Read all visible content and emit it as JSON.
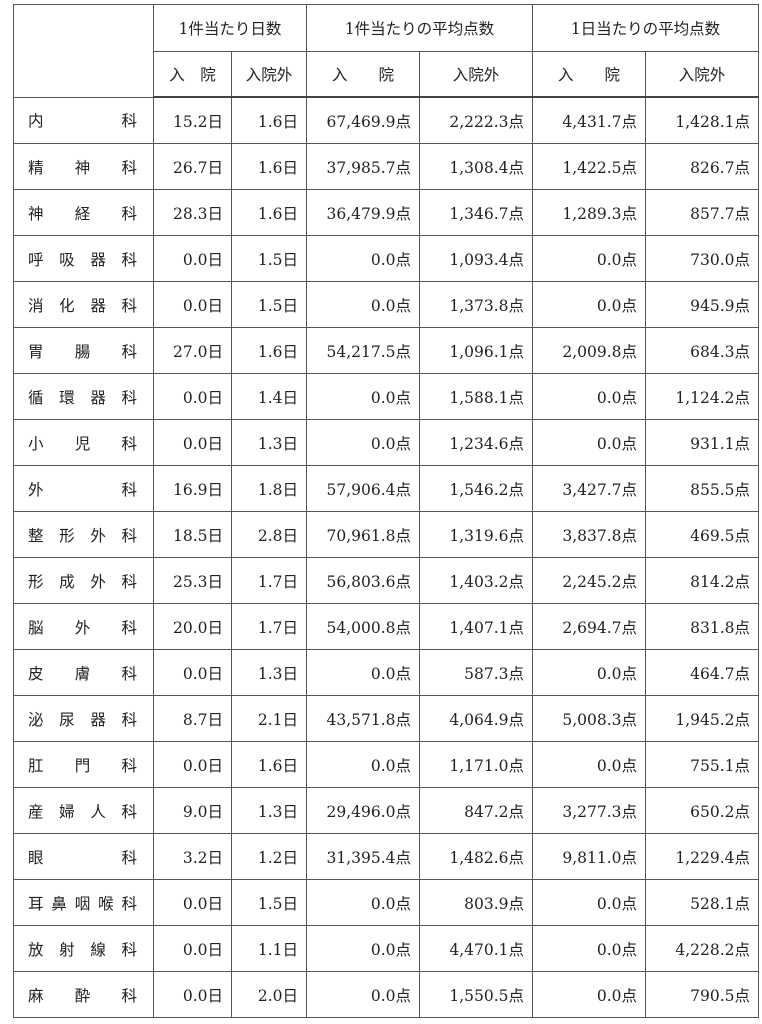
{
  "table": {
    "group_headers": [
      "1件当たり日数",
      "1件当たりの平均点数",
      "1日当たりの平均点数"
    ],
    "sub_headers": [
      "入　院",
      "入院外",
      "入　　院",
      "入院外",
      "入　　院",
      "入院外"
    ],
    "rows": [
      {
        "dept": [
          "内",
          "科"
        ],
        "days_in": "15.2日",
        "days_out": "1.6日",
        "pts_case_in": "67,469.9点",
        "pts_case_out": "2,222.3点",
        "pts_day_in": "4,431.7点",
        "pts_day_out": "1,428.1点"
      },
      {
        "dept": [
          "精",
          "神",
          "科"
        ],
        "days_in": "26.7日",
        "days_out": "1.6日",
        "pts_case_in": "37,985.7点",
        "pts_case_out": "1,308.4点",
        "pts_day_in": "1,422.5点",
        "pts_day_out": "826.7点"
      },
      {
        "dept": [
          "神",
          "経",
          "科"
        ],
        "days_in": "28.3日",
        "days_out": "1.6日",
        "pts_case_in": "36,479.9点",
        "pts_case_out": "1,346.7点",
        "pts_day_in": "1,289.3点",
        "pts_day_out": "857.7点"
      },
      {
        "dept": [
          "呼",
          "吸",
          "器",
          "科"
        ],
        "days_in": "0.0日",
        "days_out": "1.5日",
        "pts_case_in": "0.0点",
        "pts_case_out": "1,093.4点",
        "pts_day_in": "0.0点",
        "pts_day_out": "730.0点"
      },
      {
        "dept": [
          "消",
          "化",
          "器",
          "科"
        ],
        "days_in": "0.0日",
        "days_out": "1.5日",
        "pts_case_in": "0.0点",
        "pts_case_out": "1,373.8点",
        "pts_day_in": "0.0点",
        "pts_day_out": "945.9点"
      },
      {
        "dept": [
          "胃",
          "腸",
          "科"
        ],
        "days_in": "27.0日",
        "days_out": "1.6日",
        "pts_case_in": "54,217.5点",
        "pts_case_out": "1,096.1点",
        "pts_day_in": "2,009.8点",
        "pts_day_out": "684.3点"
      },
      {
        "dept": [
          "循",
          "環",
          "器",
          "科"
        ],
        "days_in": "0.0日",
        "days_out": "1.4日",
        "pts_case_in": "0.0点",
        "pts_case_out": "1,588.1点",
        "pts_day_in": "0.0点",
        "pts_day_out": "1,124.2点"
      },
      {
        "dept": [
          "小",
          "児",
          "科"
        ],
        "days_in": "0.0日",
        "days_out": "1.3日",
        "pts_case_in": "0.0点",
        "pts_case_out": "1,234.6点",
        "pts_day_in": "0.0点",
        "pts_day_out": "931.1点"
      },
      {
        "dept": [
          "外",
          "科"
        ],
        "days_in": "16.9日",
        "days_out": "1.8日",
        "pts_case_in": "57,906.4点",
        "pts_case_out": "1,546.2点",
        "pts_day_in": "3,427.7点",
        "pts_day_out": "855.5点"
      },
      {
        "dept": [
          "整",
          "形",
          "外",
          "科"
        ],
        "days_in": "18.5日",
        "days_out": "2.8日",
        "pts_case_in": "70,961.8点",
        "pts_case_out": "1,319.6点",
        "pts_day_in": "3,837.8点",
        "pts_day_out": "469.5点"
      },
      {
        "dept": [
          "形",
          "成",
          "外",
          "科"
        ],
        "days_in": "25.3日",
        "days_out": "1.7日",
        "pts_case_in": "56,803.6点",
        "pts_case_out": "1,403.2点",
        "pts_day_in": "2,245.2点",
        "pts_day_out": "814.2点"
      },
      {
        "dept": [
          "脳",
          "外",
          "科"
        ],
        "days_in": "20.0日",
        "days_out": "1.7日",
        "pts_case_in": "54,000.8点",
        "pts_case_out": "1,407.1点",
        "pts_day_in": "2,694.7点",
        "pts_day_out": "831.8点"
      },
      {
        "dept": [
          "皮",
          "膚",
          "科"
        ],
        "days_in": "0.0日",
        "days_out": "1.3日",
        "pts_case_in": "0.0点",
        "pts_case_out": "587.3点",
        "pts_day_in": "0.0点",
        "pts_day_out": "464.7点"
      },
      {
        "dept": [
          "泌",
          "尿",
          "器",
          "科"
        ],
        "days_in": "8.7日",
        "days_out": "2.1日",
        "pts_case_in": "43,571.8点",
        "pts_case_out": "4,064.9点",
        "pts_day_in": "5,008.3点",
        "pts_day_out": "1,945.2点"
      },
      {
        "dept": [
          "肛",
          "門",
          "科"
        ],
        "days_in": "0.0日",
        "days_out": "1.6日",
        "pts_case_in": "0.0点",
        "pts_case_out": "1,171.0点",
        "pts_day_in": "0.0点",
        "pts_day_out": "755.1点"
      },
      {
        "dept": [
          "産",
          "婦",
          "人",
          "科"
        ],
        "days_in": "9.0日",
        "days_out": "1.3日",
        "pts_case_in": "29,496.0点",
        "pts_case_out": "847.2点",
        "pts_day_in": "3,277.3点",
        "pts_day_out": "650.2点"
      },
      {
        "dept": [
          "眼",
          "科"
        ],
        "days_in": "3.2日",
        "days_out": "1.2日",
        "pts_case_in": "31,395.4点",
        "pts_case_out": "1,482.6点",
        "pts_day_in": "9,811.0点",
        "pts_day_out": "1,229.4点"
      },
      {
        "dept": [
          "耳",
          "鼻",
          "咽",
          "喉",
          "科"
        ],
        "days_in": "0.0日",
        "days_out": "1.5日",
        "pts_case_in": "0.0点",
        "pts_case_out": "803.9点",
        "pts_day_in": "0.0点",
        "pts_day_out": "528.1点"
      },
      {
        "dept": [
          "放",
          "射",
          "線",
          "科"
        ],
        "days_in": "0.0日",
        "days_out": "1.1日",
        "pts_case_in": "0.0点",
        "pts_case_out": "4,470.1点",
        "pts_day_in": "0.0点",
        "pts_day_out": "4,228.2点"
      },
      {
        "dept": [
          "麻",
          "酔",
          "科"
        ],
        "days_in": "0.0日",
        "days_out": "2.0日",
        "pts_case_in": "0.0点",
        "pts_case_out": "1,550.5点",
        "pts_day_in": "0.0点",
        "pts_day_out": "790.5点"
      }
    ]
  }
}
